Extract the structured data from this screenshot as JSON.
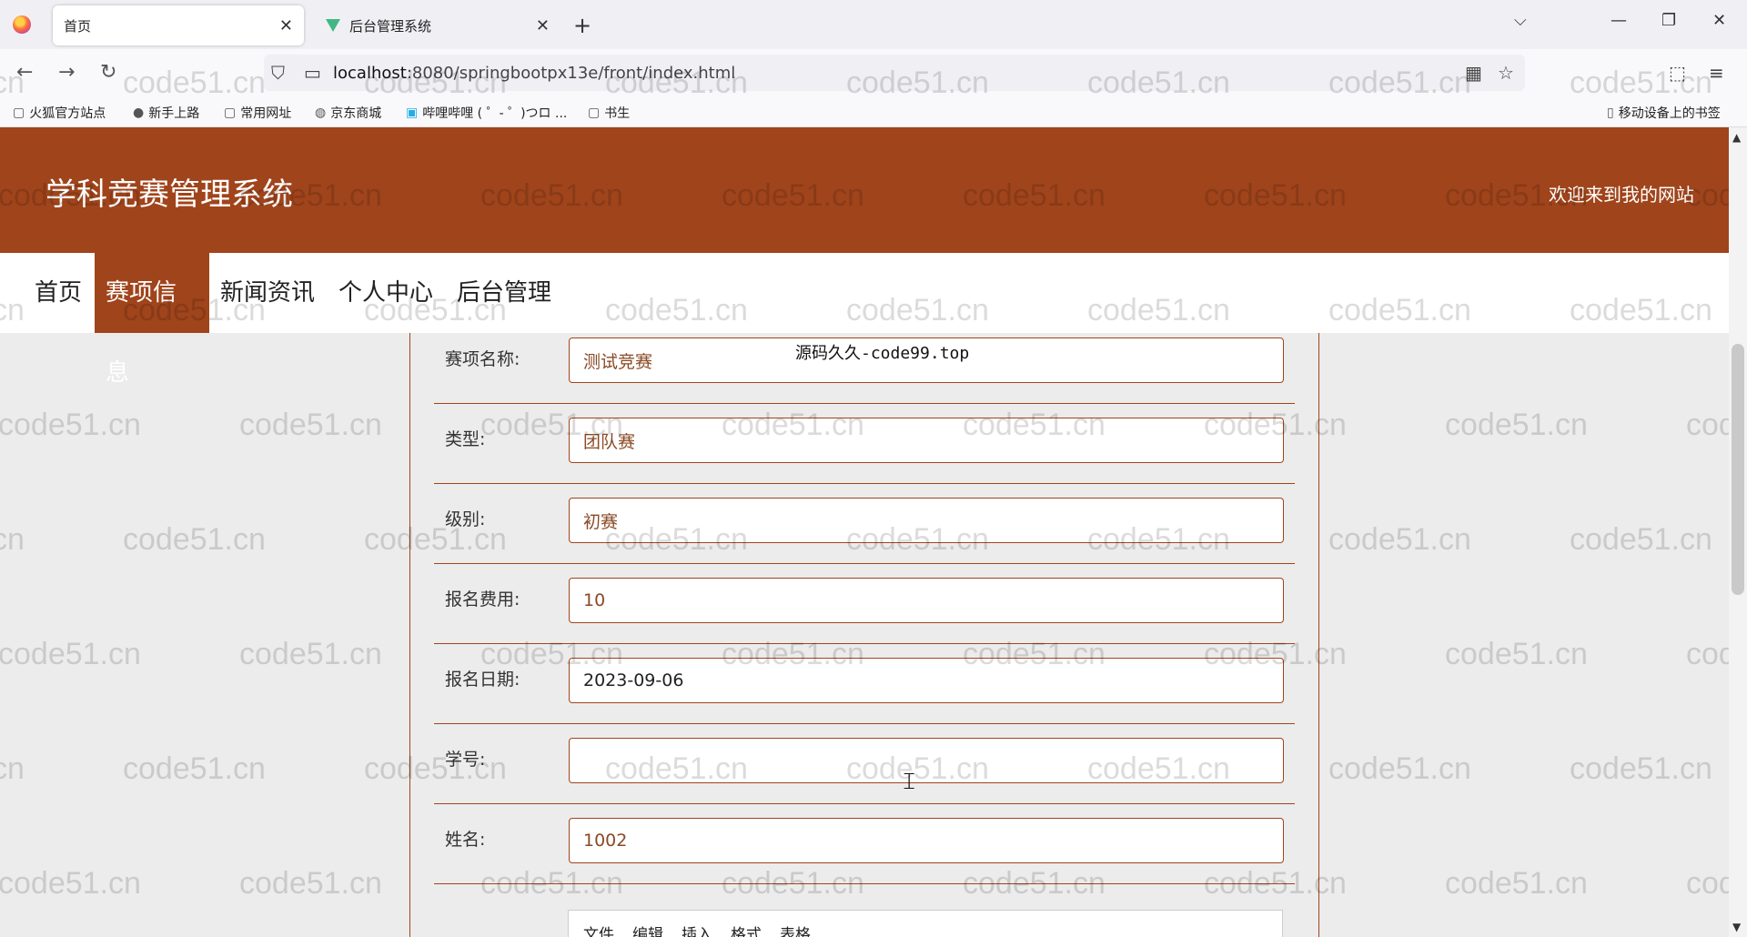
{
  "browser": {
    "tabs": [
      {
        "title": "首页",
        "active": true
      },
      {
        "title": "后台管理系统",
        "active": false
      }
    ],
    "url_host": "localhost",
    "url_rest": ":8080/springbootpx13e/front/index.html",
    "bookmarks": [
      {
        "label": "火狐官方站点",
        "icon": "firefox-icon"
      },
      {
        "label": "新手上路",
        "icon": "firefox-icon"
      },
      {
        "label": "常用网址",
        "icon": "folder-icon"
      },
      {
        "label": "京东商城",
        "icon": "globe-icon"
      },
      {
        "label": "哔哩哔哩 ( ゜- ゜)つロ ...",
        "icon": "bilibili-icon"
      },
      {
        "label": "书生",
        "icon": "folder-icon"
      }
    ],
    "mobile_bookmarks": "移动设备上的书签"
  },
  "site": {
    "title": "学科竞赛管理系统",
    "welcome": "欢迎来到我的网站",
    "brand_color": "#a0441b",
    "menu": [
      {
        "label": "首页",
        "active": false
      },
      {
        "label": "赛项信息",
        "active": true
      },
      {
        "label": "新闻资讯",
        "active": false
      },
      {
        "label": "个人中心",
        "active": false
      },
      {
        "label": "后台管理",
        "active": false
      }
    ]
  },
  "form": {
    "fields": [
      {
        "label": "赛项名称:",
        "value": "测试竞赛"
      },
      {
        "label": "类型:",
        "value": "团队赛"
      },
      {
        "label": "级别:",
        "value": "初赛"
      },
      {
        "label": "报名费用:",
        "value": "10"
      },
      {
        "label": "报名日期:",
        "value": "2023-09-06"
      },
      {
        "label": "学号:",
        "value": ""
      },
      {
        "label": "姓名:",
        "value": "1002"
      }
    ],
    "editor_menu": [
      "文件",
      "编辑",
      "插入",
      "格式",
      "表格"
    ]
  },
  "overlay_text": "源码久久-code99.top",
  "watermark": "code51.cn"
}
